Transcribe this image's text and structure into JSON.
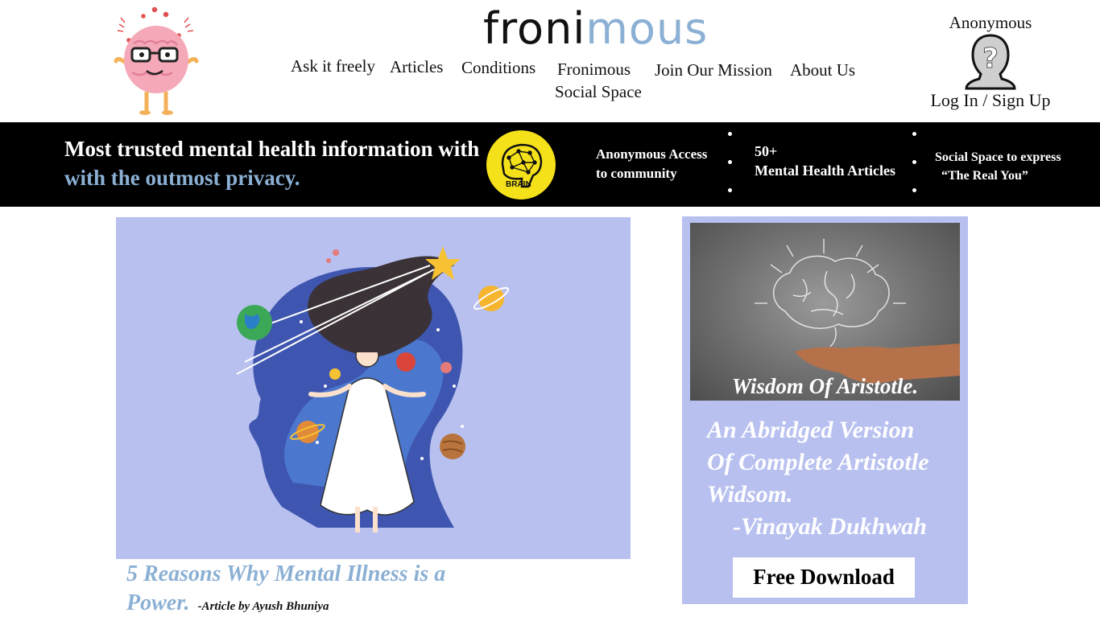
{
  "logo": {
    "part1": "froni",
    "part2": "mous"
  },
  "nav": [
    {
      "label": "Ask it freely"
    },
    {
      "label": "Articles"
    },
    {
      "label": "Conditions"
    },
    {
      "label": "Fronimous"
    },
    {
      "label": "Social Space"
    },
    {
      "label": "Join Our Mission"
    },
    {
      "label": "About Us"
    }
  ],
  "user": {
    "name": "Anonymous",
    "login_label": "Log In / Sign Up"
  },
  "banner": {
    "headline": "Most trusted mental health information with",
    "subline": "with the outmost privacy.",
    "badge_text": "BRAIN",
    "features": [
      {
        "line1": "Anonymous Access",
        "line2": "to community"
      },
      {
        "line1": "50+",
        "line2": "Mental Health Articles"
      },
      {
        "line1": "Social Space to express",
        "line2": "“The Real You”"
      }
    ]
  },
  "article": {
    "title_line1": "5 Reasons Why Mental Illness is a",
    "title_line2": "Power.",
    "byline": "-Article by Ayush Bhuniya"
  },
  "ad": {
    "caption": "Wisdom Of Aristotle.",
    "text_line1": "An Abridged Version",
    "text_line2": "Of Complete Artistotle",
    "text_line3": "Widsom.",
    "author": "-Vinayak Dukhwah",
    "button_label": "Free Download"
  },
  "colors": {
    "accent_blue": "#8bb0d4",
    "panel_lavender": "#b8c0ef",
    "banner_black": "#000000",
    "badge_yellow": "#f5e11a"
  }
}
